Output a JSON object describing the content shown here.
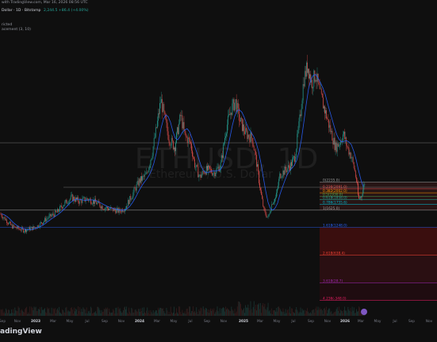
{
  "header": {
    "published": "with TradingView.com, Mar 16, 2026 08:56 UTC",
    "symbol_line": "Dollar · 1D · Bitstamp",
    "ohlc_text": "2,244.5  +86.4 (+4.00%)",
    "indicator_1": "ricted",
    "indicator_2": "acement (3, 10)"
  },
  "watermark": {
    "symbol": "ETHUSD, 1D",
    "description": "Ethereum / U.S. Dollar"
  },
  "brand": "adingView",
  "fib_levels": [
    {
      "label": "0(2235.0)",
      "price": 2235
    },
    {
      "label": "0.236(2091.0)",
      "price": 2091
    },
    {
      "label": "0.382(2002.0)",
      "price": 2002
    },
    {
      "label": "0.5(1930.0)",
      "price": 1930
    },
    {
      "label": "0.618(1858.0)",
      "price": 1858
    },
    {
      "label": "0.786(1755.6)",
      "price": 1755.6
    },
    {
      "label": "1(1625.0)",
      "price": 1625
    },
    {
      "label": "1.618(1248.0)",
      "price": 1248
    },
    {
      "label": "2.618(638.4)",
      "price": 638.4
    },
    {
      "label": "3.618(28.7)",
      "price": 28.7
    },
    {
      "label": "4.236(-348.0)",
      "price": -348
    }
  ],
  "x_axis_labels": [
    "Sep",
    "Nov",
    "2023",
    "Mar",
    "May",
    "Jul",
    "Sep",
    "Nov",
    "2024",
    "Mar",
    "May",
    "Jul",
    "Sep",
    "Nov",
    "2025",
    "Mar",
    "May",
    "Jul",
    "Sep",
    "Nov",
    "2026",
    "Mar",
    "May",
    "Jul",
    "Sep",
    "Nov"
  ],
  "colors": {
    "background": "#0f0f0f",
    "up": "#26a69a",
    "down": "#ef5350",
    "ma": "#2962ff",
    "fib_zone_dark": "#4a1414",
    "fib_zone_red": "#3a0e0e"
  }
}
